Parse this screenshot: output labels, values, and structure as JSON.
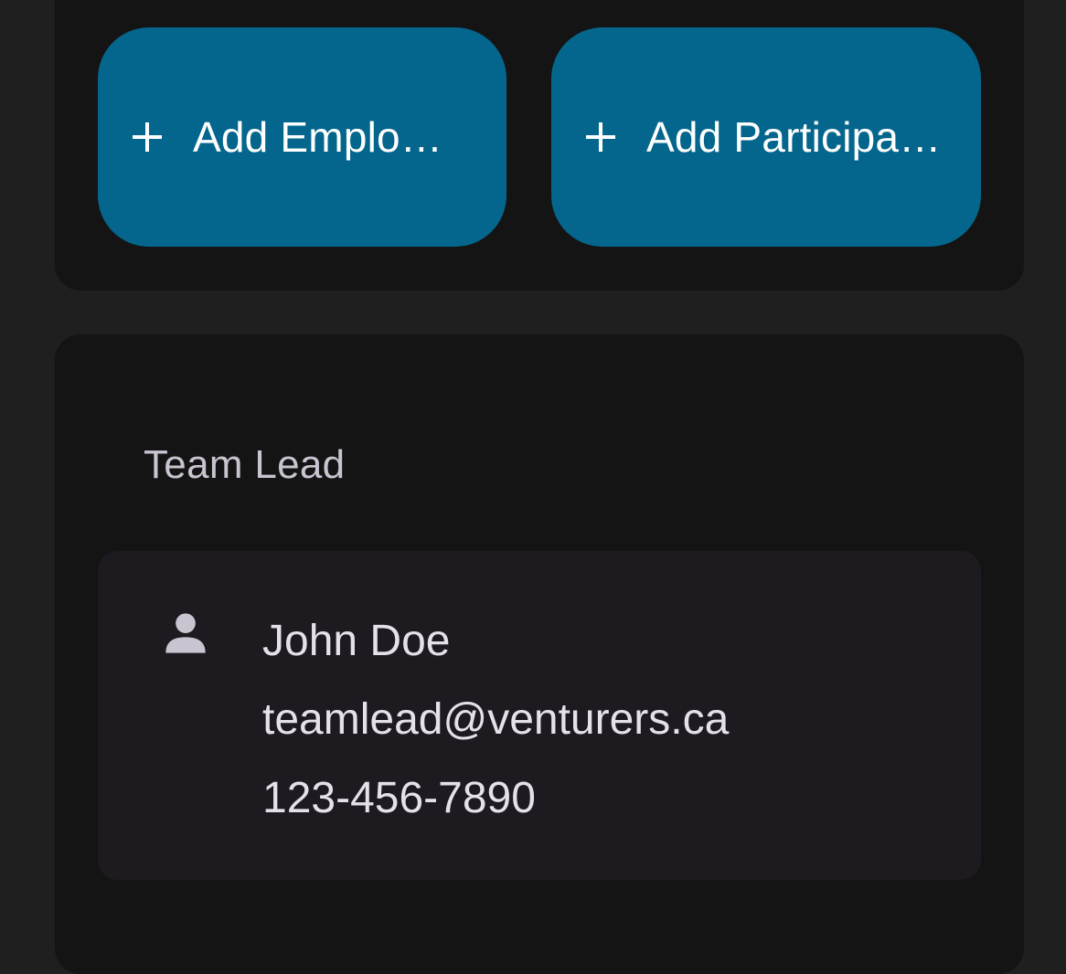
{
  "actions": {
    "add_employee_label": "Add Employ…",
    "add_participant_label": "Add Participa…",
    "icon": "plus-icon"
  },
  "team_lead": {
    "section_title": "Team Lead",
    "icon": "person-icon",
    "name": "John Doe",
    "email": "teamlead@venturers.ca",
    "phone": "123-456-7890"
  },
  "colors": {
    "background": "#1f1f1f",
    "card": "#141414",
    "button": "#05668d",
    "tile": "#1d1b20",
    "muted_text": "#cac4d0",
    "text": "#e6e0e9"
  }
}
